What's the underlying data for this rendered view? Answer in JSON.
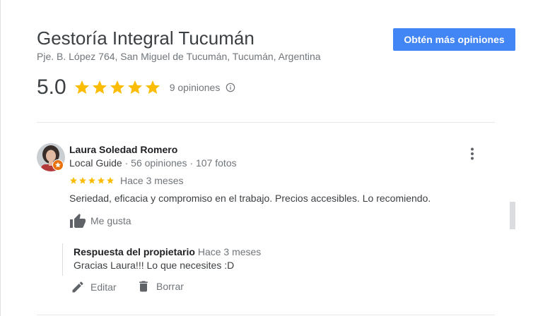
{
  "business": {
    "name": "Gestoría Integral Tucumán",
    "address": "Pje. B. López 764, San Miguel de Tucumán, Tucumán, Argentina",
    "rating": "5.0",
    "stars_filled": 5,
    "review_count_label": "9 opiniones",
    "cta_label": "Obtén más opiniones"
  },
  "review": {
    "author": "Laura Soledad Romero",
    "guide_label": "Local Guide",
    "stats": "· 56 opiniones · 107 fotos",
    "stars": 5,
    "date": "Hace 3 meses",
    "text": "Seriedad, eficacia y compromiso en el trabajo. Precios accesibles. Lo recomiendo.",
    "like_label": "Me gusta"
  },
  "owner_response": {
    "title": "Respuesta del propietario",
    "date": "Hace 3 meses",
    "text": "Gracias Laura!!! Lo que necesites :D"
  },
  "actions": {
    "edit_label": "Editar",
    "delete_label": "Borrar"
  },
  "colors": {
    "star": "#fbbc04",
    "button_blue": "#4285f4",
    "badge_orange": "#e8710a"
  }
}
